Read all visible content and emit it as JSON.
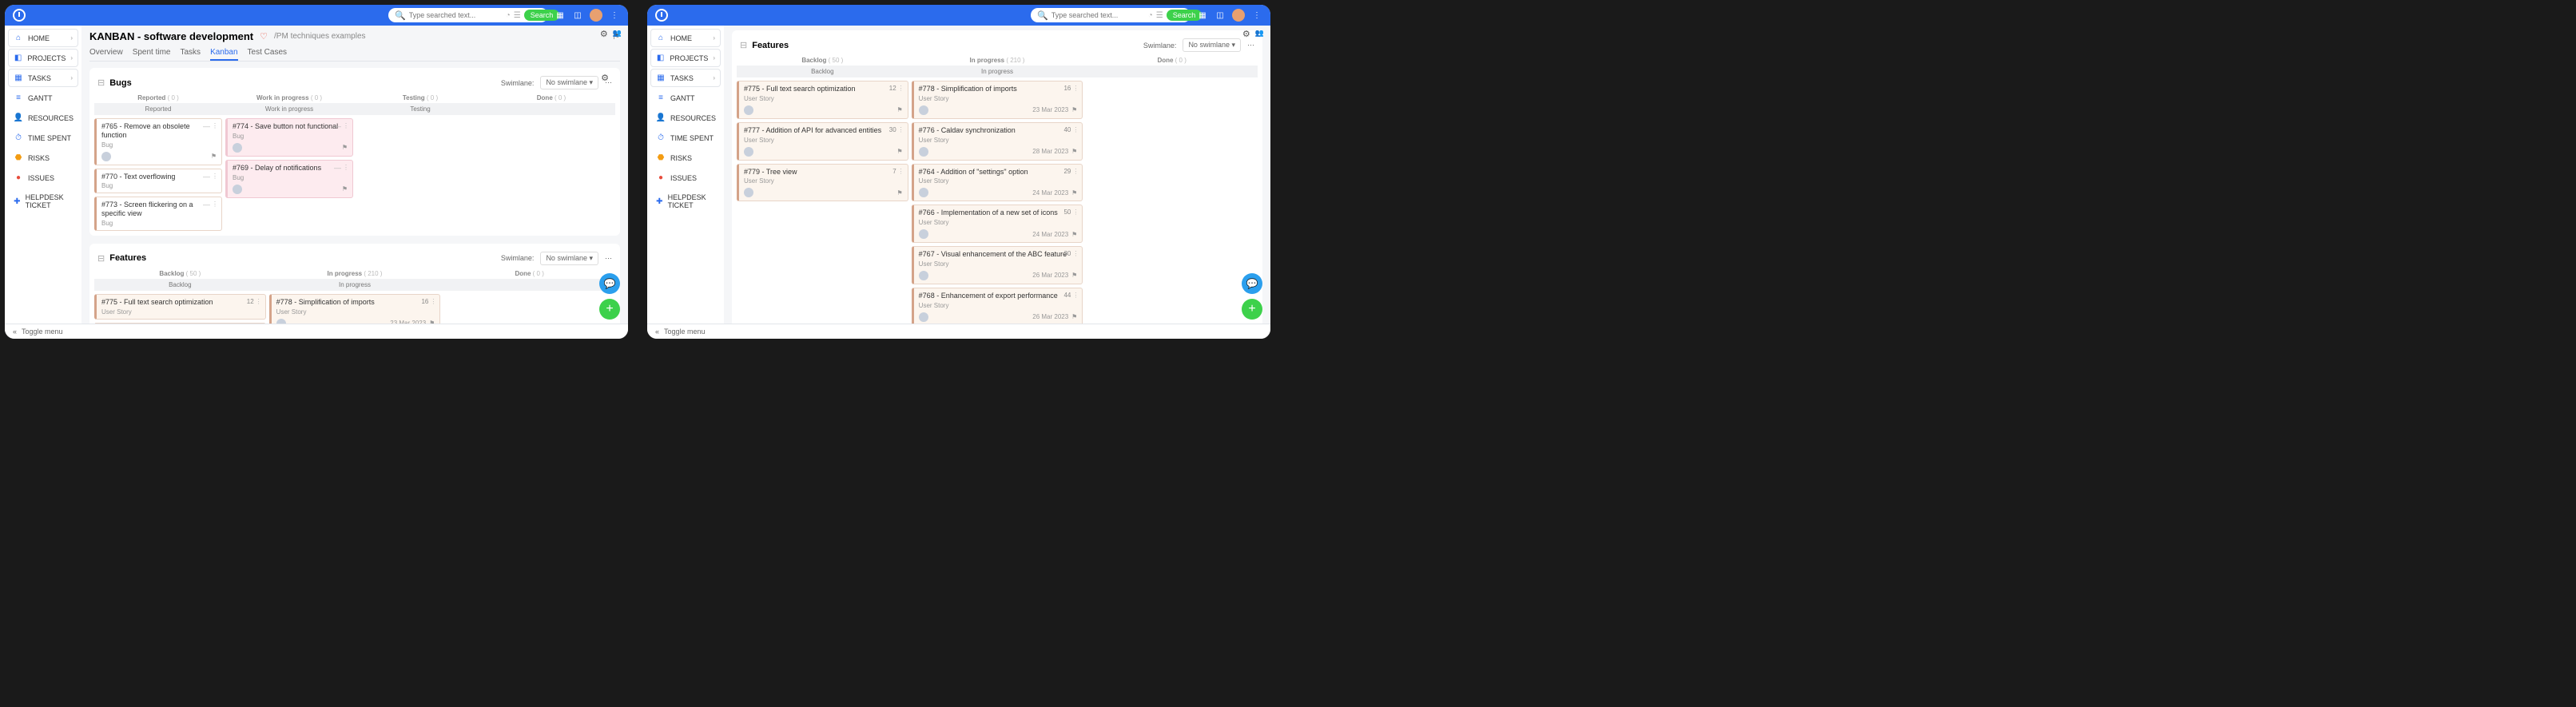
{
  "search": {
    "placeholder": "Type searched text...",
    "button": "Search"
  },
  "sidebar": {
    "items": [
      {
        "label": "HOME",
        "icon": "⌂",
        "color": "c-blue",
        "chev": true
      },
      {
        "label": "PROJECTS",
        "icon": "◧",
        "color": "c-blue",
        "chev": true
      },
      {
        "label": "TASKS",
        "icon": "▦",
        "color": "c-blue",
        "chev": true
      },
      {
        "label": "GANTT",
        "icon": "≡",
        "color": "c-blue",
        "chev": false
      },
      {
        "label": "RESOURCES",
        "icon": "👤",
        "color": "c-blue",
        "chev": false
      },
      {
        "label": "TIME SPENT",
        "icon": "⏱",
        "color": "c-blue",
        "chev": false
      },
      {
        "label": "RISKS",
        "icon": "⬣",
        "color": "c-orange",
        "chev": false
      },
      {
        "label": "ISSUES",
        "icon": "●",
        "color": "c-red",
        "chev": false
      },
      {
        "label": "HELPDESK TICKET",
        "icon": "✚",
        "color": "c-blue",
        "chev": false
      }
    ]
  },
  "page": {
    "title": "KANBAN - software development",
    "breadcrumb": "/PM techniques examples",
    "tabs": [
      "Overview",
      "Spent time",
      "Tasks",
      "Kanban",
      "Test Cases"
    ],
    "active_tab": "Kanban"
  },
  "swimlane": {
    "label": "Swimlane:",
    "value": "No swimlane"
  },
  "sections": {
    "bugs": {
      "title": "Bugs",
      "col_headers": [
        {
          "name": "Reported",
          "count": "( 0 )"
        },
        {
          "name": "Work in progress",
          "count": "( 0 )"
        },
        {
          "name": "Testing",
          "count": "( 0 )"
        },
        {
          "name": "Done",
          "count": "( 0 )"
        }
      ],
      "sub_headers": [
        "Reported",
        "Work in progress",
        "Testing"
      ],
      "cols": [
        [
          {
            "title": "#765 - Remove an obsolete function",
            "type": "Bug",
            "meta": true
          },
          {
            "title": "#770 - Text overflowing",
            "type": "Bug"
          },
          {
            "title": "#773 - Screen flickering on a specific view",
            "type": "Bug"
          }
        ],
        [
          {
            "title": "#774 - Save button not functional",
            "type": "Bug",
            "pink": true,
            "meta": true
          },
          {
            "title": "#769 - Delay of notifications",
            "type": "Bug",
            "pink": true,
            "meta": true
          }
        ],
        [],
        []
      ]
    },
    "features_a": {
      "title": "Features",
      "col_headers": [
        {
          "name": "Backlog",
          "count": "( 50 )"
        },
        {
          "name": "In progress",
          "count": "( 210 )"
        },
        {
          "name": "Done",
          "count": "( 0 )"
        }
      ],
      "sub_headers": [
        "Backlog",
        "In progress"
      ],
      "cols": [
        [
          {
            "title": "#775 - Full text search optimization",
            "type": "User Story",
            "num": "12"
          },
          {
            "title": "#777 - Addition of API for advanced entities"
          }
        ],
        [
          {
            "title": "#778 - Simplification of imports",
            "type": "User Story",
            "num": "16",
            "date": "23 Mar 2023",
            "meta": true
          },
          {
            "title": "#776 - Caldav synchronization"
          }
        ],
        []
      ]
    },
    "features_b": {
      "title": "Features",
      "col_headers": [
        {
          "name": "Backlog",
          "count": "( 50 )"
        },
        {
          "name": "In progress",
          "count": "( 210 )"
        },
        {
          "name": "Done",
          "count": "( 0 )"
        }
      ],
      "sub_headers": [
        "Backlog",
        "In progress"
      ],
      "cols": [
        [
          {
            "title": "#775 - Full text search optimization",
            "type": "User Story",
            "num": "12",
            "meta": true
          },
          {
            "title": "#777 - Addition of API for advanced entities",
            "type": "User Story",
            "num": "30",
            "meta": true
          },
          {
            "title": "#779 - Tree view",
            "type": "User Story",
            "num": "7",
            "meta": true
          }
        ],
        [
          {
            "title": "#778 - Simplification of imports",
            "type": "User Story",
            "num": "16",
            "date": "23 Mar 2023",
            "meta": true
          },
          {
            "title": "#776 - Caldav synchronization",
            "type": "User Story",
            "num": "40",
            "date": "28 Mar 2023",
            "meta": true
          },
          {
            "title": "#764 - Addition of \"settings\" option",
            "type": "User Story",
            "num": "29",
            "date": "24 Mar 2023",
            "meta": true
          },
          {
            "title": "#766 - Implementation of a new set of icons",
            "type": "User Story",
            "num": "50",
            "date": "24 Mar 2023",
            "meta": true
          },
          {
            "title": "#767 - Visual enhancement of the ABC feature",
            "type": "User Story",
            "num": "30",
            "date": "26 Mar 2023",
            "meta": true
          },
          {
            "title": "#768 - Enhancement of export performance",
            "type": "User Story",
            "num": "44",
            "date": "26 Mar 2023",
            "meta": true
          }
        ],
        []
      ]
    }
  },
  "footer": {
    "toggle": "Toggle menu"
  }
}
